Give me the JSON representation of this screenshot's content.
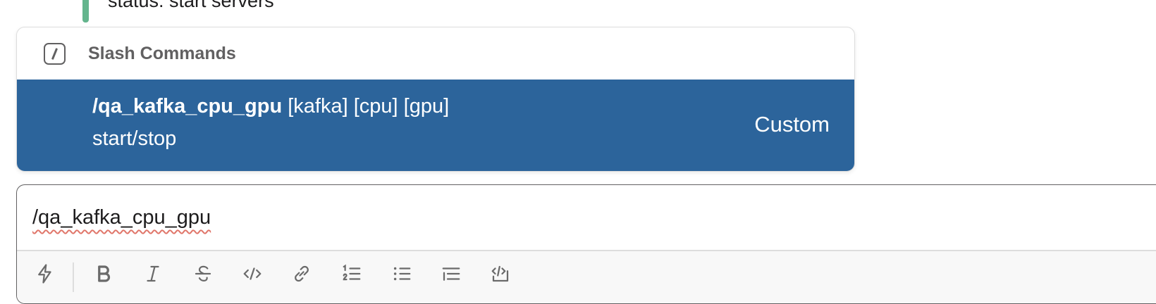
{
  "message": {
    "text": "status: start servers",
    "bar_color": "#64b58d"
  },
  "popup": {
    "title": "Slash Commands",
    "icon": "slash-command-icon",
    "commands": [
      {
        "name": "/qa_kafka_cpu_gpu",
        "args": "[kafka] [cpu] [gpu]",
        "description": "start/stop",
        "type": "Custom"
      }
    ],
    "highlight_color": "#2c649b"
  },
  "composer": {
    "value": "/qa_kafka_cpu_gpu",
    "toolbar": [
      {
        "name": "shortcuts-icon",
        "label": "Shortcuts"
      },
      {
        "name": "bold-icon",
        "label": "Bold"
      },
      {
        "name": "italic-icon",
        "label": "Italic"
      },
      {
        "name": "strikethrough-icon",
        "label": "Strikethrough"
      },
      {
        "name": "code-icon",
        "label": "Code"
      },
      {
        "name": "link-icon",
        "label": "Link"
      },
      {
        "name": "ordered-list-icon",
        "label": "Ordered list"
      },
      {
        "name": "bulleted-list-icon",
        "label": "Bulleted list"
      },
      {
        "name": "blockquote-icon",
        "label": "Blockquote"
      },
      {
        "name": "code-block-icon",
        "label": "Code block"
      }
    ]
  }
}
